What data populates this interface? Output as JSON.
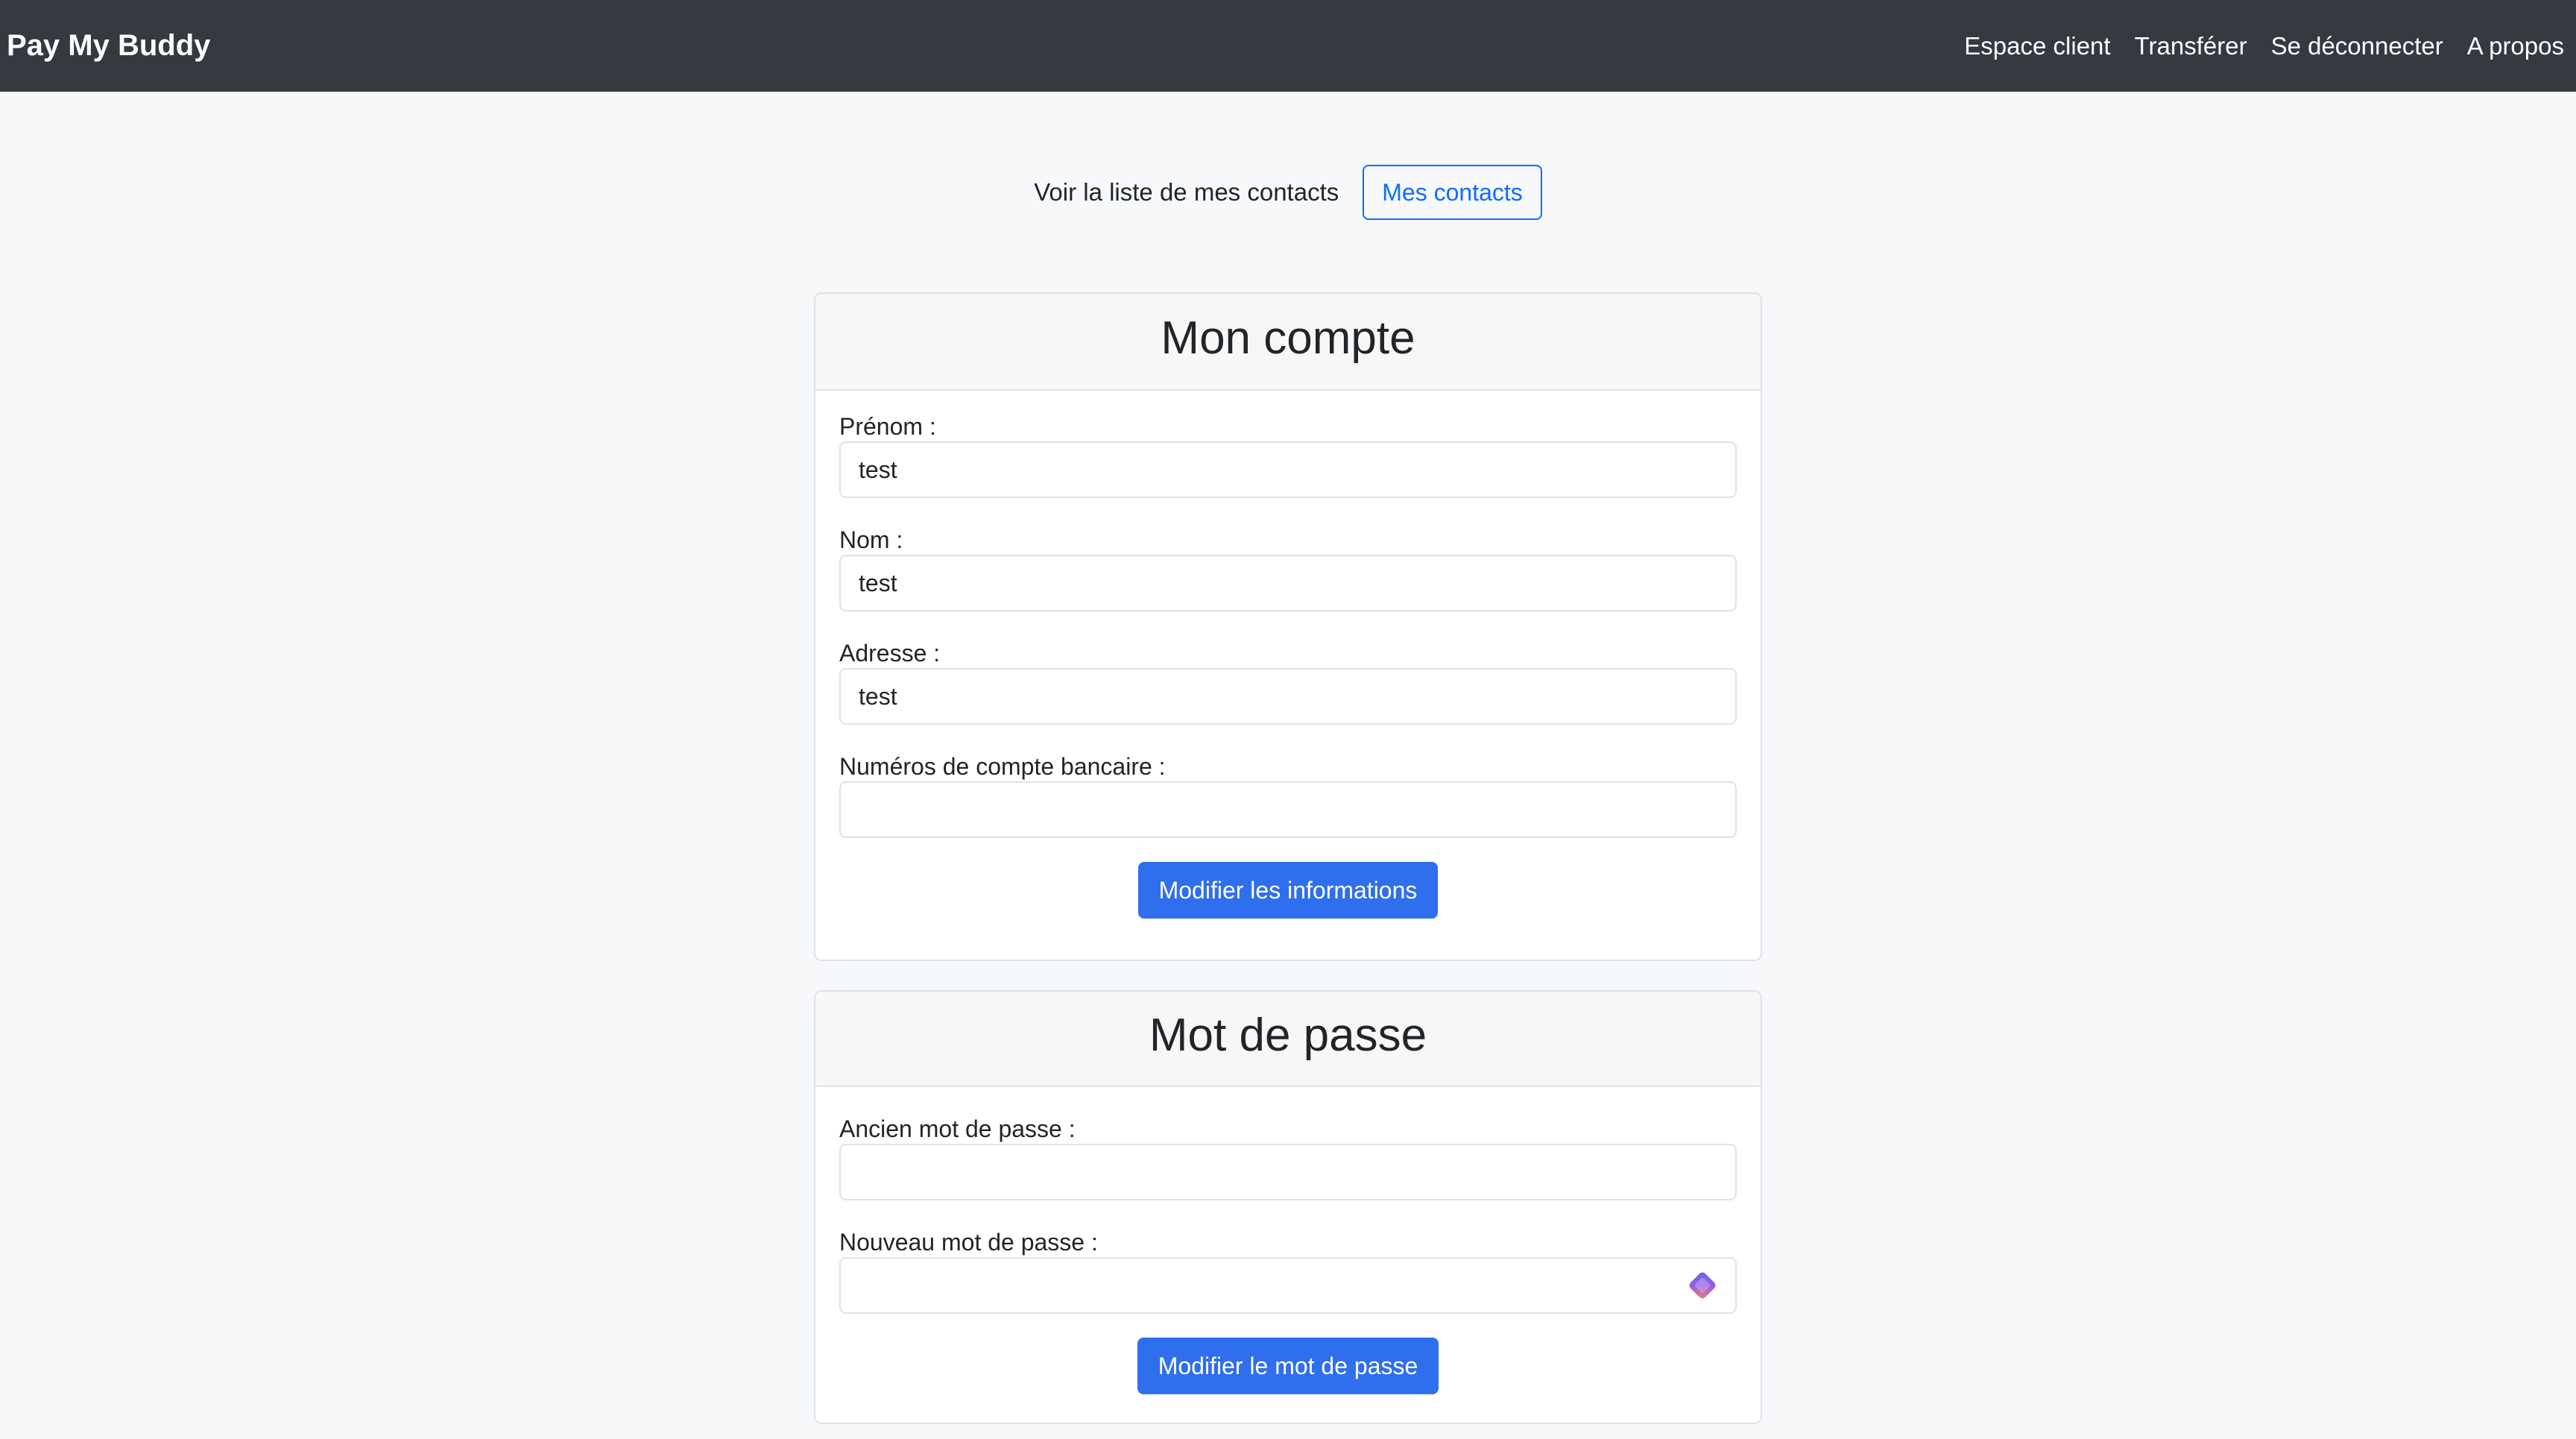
{
  "navbar": {
    "brand": "Pay My Buddy",
    "links": [
      "Espace client",
      "Transférer",
      "Se déconnecter",
      "A propos"
    ]
  },
  "contacts": {
    "text": "Voir la liste de mes contacts",
    "button": "Mes contacts"
  },
  "account": {
    "title": "Mon compte",
    "fields": [
      {
        "label": "Prénom :",
        "value": "test"
      },
      {
        "label": "Nom :",
        "value": "test"
      },
      {
        "label": "Adresse :",
        "value": "test"
      },
      {
        "label": "Numéros de compte bancaire :",
        "value": ""
      }
    ],
    "submit": "Modifier les informations"
  },
  "password": {
    "title": "Mot de passe",
    "fields": [
      {
        "label": "Ancien mot de passe :",
        "value": ""
      },
      {
        "label": "Nouveau mot de passe :",
        "value": ""
      }
    ],
    "submit": "Modifier le mot de passe",
    "autofill_icon": "password-manager-icon"
  },
  "colors": {
    "navbar_bg": "#343a40",
    "primary": "#2f6fed",
    "outline": "#0d6efd",
    "page_bg": "#f7f8fa"
  }
}
